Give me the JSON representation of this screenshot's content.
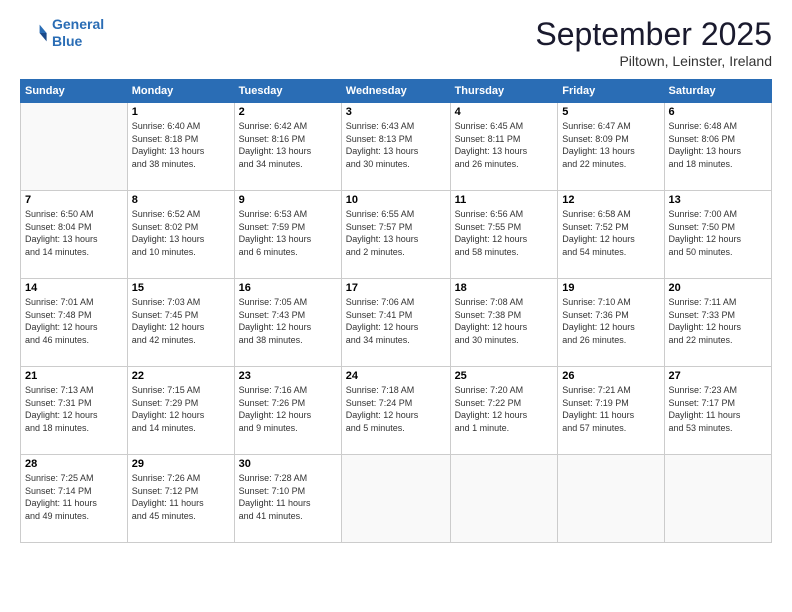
{
  "header": {
    "logo_line1": "General",
    "logo_line2": "Blue",
    "month_title": "September 2025",
    "subtitle": "Piltown, Leinster, Ireland"
  },
  "days_of_week": [
    "Sunday",
    "Monday",
    "Tuesday",
    "Wednesday",
    "Thursday",
    "Friday",
    "Saturday"
  ],
  "weeks": [
    [
      {
        "day": "",
        "info": ""
      },
      {
        "day": "1",
        "info": "Sunrise: 6:40 AM\nSunset: 8:18 PM\nDaylight: 13 hours\nand 38 minutes."
      },
      {
        "day": "2",
        "info": "Sunrise: 6:42 AM\nSunset: 8:16 PM\nDaylight: 13 hours\nand 34 minutes."
      },
      {
        "day": "3",
        "info": "Sunrise: 6:43 AM\nSunset: 8:13 PM\nDaylight: 13 hours\nand 30 minutes."
      },
      {
        "day": "4",
        "info": "Sunrise: 6:45 AM\nSunset: 8:11 PM\nDaylight: 13 hours\nand 26 minutes."
      },
      {
        "day": "5",
        "info": "Sunrise: 6:47 AM\nSunset: 8:09 PM\nDaylight: 13 hours\nand 22 minutes."
      },
      {
        "day": "6",
        "info": "Sunrise: 6:48 AM\nSunset: 8:06 PM\nDaylight: 13 hours\nand 18 minutes."
      }
    ],
    [
      {
        "day": "7",
        "info": "Sunrise: 6:50 AM\nSunset: 8:04 PM\nDaylight: 13 hours\nand 14 minutes."
      },
      {
        "day": "8",
        "info": "Sunrise: 6:52 AM\nSunset: 8:02 PM\nDaylight: 13 hours\nand 10 minutes."
      },
      {
        "day": "9",
        "info": "Sunrise: 6:53 AM\nSunset: 7:59 PM\nDaylight: 13 hours\nand 6 minutes."
      },
      {
        "day": "10",
        "info": "Sunrise: 6:55 AM\nSunset: 7:57 PM\nDaylight: 13 hours\nand 2 minutes."
      },
      {
        "day": "11",
        "info": "Sunrise: 6:56 AM\nSunset: 7:55 PM\nDaylight: 12 hours\nand 58 minutes."
      },
      {
        "day": "12",
        "info": "Sunrise: 6:58 AM\nSunset: 7:52 PM\nDaylight: 12 hours\nand 54 minutes."
      },
      {
        "day": "13",
        "info": "Sunrise: 7:00 AM\nSunset: 7:50 PM\nDaylight: 12 hours\nand 50 minutes."
      }
    ],
    [
      {
        "day": "14",
        "info": "Sunrise: 7:01 AM\nSunset: 7:48 PM\nDaylight: 12 hours\nand 46 minutes."
      },
      {
        "day": "15",
        "info": "Sunrise: 7:03 AM\nSunset: 7:45 PM\nDaylight: 12 hours\nand 42 minutes."
      },
      {
        "day": "16",
        "info": "Sunrise: 7:05 AM\nSunset: 7:43 PM\nDaylight: 12 hours\nand 38 minutes."
      },
      {
        "day": "17",
        "info": "Sunrise: 7:06 AM\nSunset: 7:41 PM\nDaylight: 12 hours\nand 34 minutes."
      },
      {
        "day": "18",
        "info": "Sunrise: 7:08 AM\nSunset: 7:38 PM\nDaylight: 12 hours\nand 30 minutes."
      },
      {
        "day": "19",
        "info": "Sunrise: 7:10 AM\nSunset: 7:36 PM\nDaylight: 12 hours\nand 26 minutes."
      },
      {
        "day": "20",
        "info": "Sunrise: 7:11 AM\nSunset: 7:33 PM\nDaylight: 12 hours\nand 22 minutes."
      }
    ],
    [
      {
        "day": "21",
        "info": "Sunrise: 7:13 AM\nSunset: 7:31 PM\nDaylight: 12 hours\nand 18 minutes."
      },
      {
        "day": "22",
        "info": "Sunrise: 7:15 AM\nSunset: 7:29 PM\nDaylight: 12 hours\nand 14 minutes."
      },
      {
        "day": "23",
        "info": "Sunrise: 7:16 AM\nSunset: 7:26 PM\nDaylight: 12 hours\nand 9 minutes."
      },
      {
        "day": "24",
        "info": "Sunrise: 7:18 AM\nSunset: 7:24 PM\nDaylight: 12 hours\nand 5 minutes."
      },
      {
        "day": "25",
        "info": "Sunrise: 7:20 AM\nSunset: 7:22 PM\nDaylight: 12 hours\nand 1 minute."
      },
      {
        "day": "26",
        "info": "Sunrise: 7:21 AM\nSunset: 7:19 PM\nDaylight: 11 hours\nand 57 minutes."
      },
      {
        "day": "27",
        "info": "Sunrise: 7:23 AM\nSunset: 7:17 PM\nDaylight: 11 hours\nand 53 minutes."
      }
    ],
    [
      {
        "day": "28",
        "info": "Sunrise: 7:25 AM\nSunset: 7:14 PM\nDaylight: 11 hours\nand 49 minutes."
      },
      {
        "day": "29",
        "info": "Sunrise: 7:26 AM\nSunset: 7:12 PM\nDaylight: 11 hours\nand 45 minutes."
      },
      {
        "day": "30",
        "info": "Sunrise: 7:28 AM\nSunset: 7:10 PM\nDaylight: 11 hours\nand 41 minutes."
      },
      {
        "day": "",
        "info": ""
      },
      {
        "day": "",
        "info": ""
      },
      {
        "day": "",
        "info": ""
      },
      {
        "day": "",
        "info": ""
      }
    ]
  ]
}
